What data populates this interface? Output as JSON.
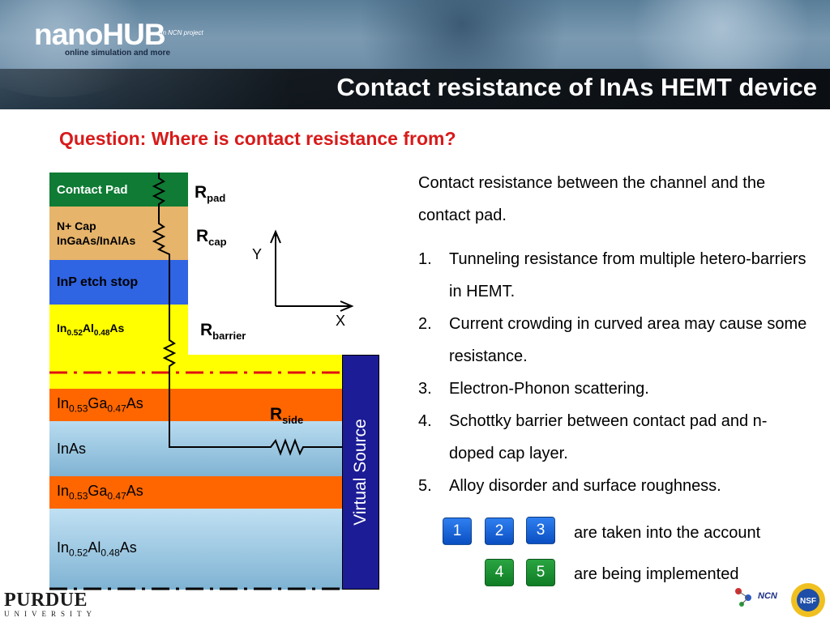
{
  "header": {
    "logo": "nanoHUB",
    "logo_subtitle": "online simulation and more",
    "logo_tag": "an NCN project",
    "title": "Contact resistance of InAs HEMT device"
  },
  "question": "Question: Where is contact resistance from?",
  "diagram": {
    "layers": {
      "contact_pad": "Contact Pad",
      "n_cap_1": "N+ Cap",
      "n_cap_2": "InGaAs/InAlAs",
      "inp_etch_stop": "InP etch stop",
      "inalas_top": {
        "base1": "In",
        "sub1": "0.52",
        "base2": "Al",
        "sub2": "0.48",
        "base3": "As"
      },
      "ingaas_1": {
        "base1": "In",
        "sub1": "0.53",
        "base2": "Ga",
        "sub2": "0.47",
        "base3": "As"
      },
      "inas": "InAs",
      "ingaas_2": {
        "base1": "In",
        "sub1": "0.53",
        "base2": "Ga",
        "sub2": "0.47",
        "base3": "As"
      },
      "inalas_bottom": {
        "base1": "In",
        "sub1": "0.52",
        "base2": "Al",
        "sub2": "0.48",
        "base3": "As"
      }
    },
    "resistors": {
      "pad": {
        "main": "R",
        "sub": "pad"
      },
      "cap": {
        "main": "R",
        "sub": "cap"
      },
      "barrier": {
        "main": "R",
        "sub": "barrier"
      },
      "side": {
        "main": "R",
        "sub": "side"
      }
    },
    "axis_y": "Y",
    "axis_x": "X",
    "virtual_source": "Virtual Source",
    "colors": {
      "contact_pad": "#0f7b34",
      "n_cap": "#e6b46b",
      "inp": "#2f64e3",
      "inalas": "#ffff00",
      "ingaas": "#ff6600",
      "inas": "#8fc3e0",
      "virtual_source": "#1c1c96",
      "dash_line": "#e01010"
    }
  },
  "content": {
    "intro": "Contact resistance between the channel and the contact pad.",
    "items": [
      {
        "num": "1.",
        "text": "Tunneling resistance from multiple hetero-barriers in HEMT."
      },
      {
        "num": "2.",
        "text": "Current crowding in curved area may cause some resistance."
      },
      {
        "num": "3.",
        "text": "Electron-Phonon scattering."
      },
      {
        "num": "4.",
        "text": "Schottky barrier between contact pad and n-doped cap layer."
      },
      {
        "num": "5.",
        "text": "Alloy disorder and surface roughness."
      }
    ],
    "legend": {
      "accounted_badges": [
        "1",
        "2",
        "3"
      ],
      "accounted_text": "are taken into the account",
      "implemented_badges": [
        "4",
        "5"
      ],
      "implemented_text": "are being implemented"
    }
  },
  "footer": {
    "purdue": "PURDUE",
    "university": "UNIVERSITY",
    "ncn": "NCN",
    "nsf": "NSF"
  }
}
